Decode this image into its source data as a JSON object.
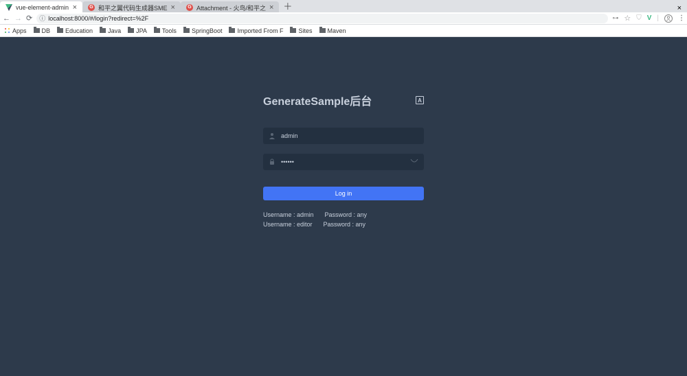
{
  "tabs": [
    {
      "label": "vue-element-admin"
    },
    {
      "label": "和平之翼代码生成器SME"
    },
    {
      "label": "Attachment - 火鸟/和平之"
    }
  ],
  "address": {
    "info_label": "ⓘ",
    "host": "localhost",
    "port_path": ":8000/#/login?redirect=%2F"
  },
  "bookmarks": [
    "Apps",
    "DB",
    "Education",
    "Java",
    "JPA",
    "Tools",
    "SpringBoot",
    "Imported From F",
    "Sites",
    "Maven"
  ],
  "login": {
    "title": "GenerateSample后台",
    "username_value": "admin",
    "password_value": "••••••",
    "button_label": "Log in",
    "hints": {
      "u1": "Username : admin",
      "p1": "Password : any",
      "u2": "Username : editor",
      "p2": "Password : any"
    }
  }
}
